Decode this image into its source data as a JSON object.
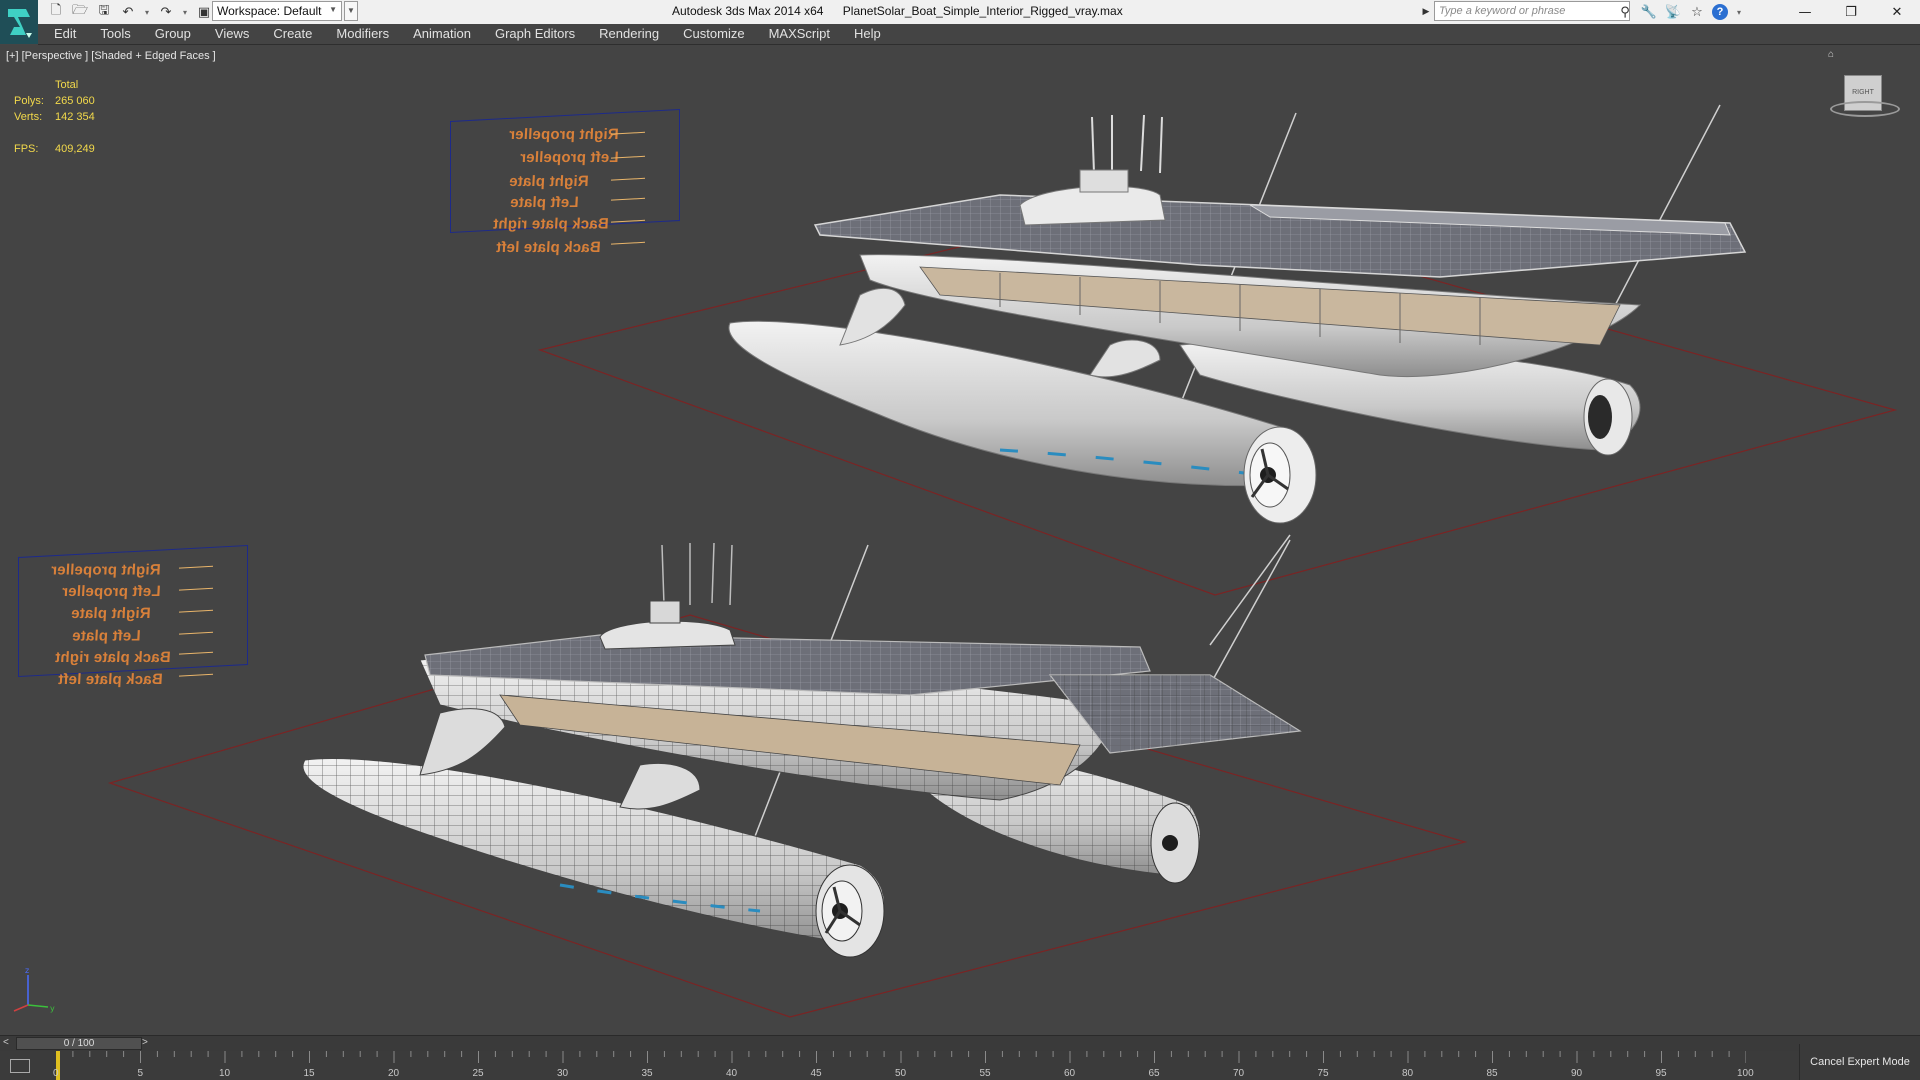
{
  "titlebar": {
    "app_name": "Autodesk 3ds Max  2014 x64",
    "file_name": "PlanetSolar_Boat_Simple_Interior_Rigged_vray.max",
    "workspace_label": "Workspace: Default",
    "search_placeholder": "Type a keyword or phrase"
  },
  "menu": [
    "Edit",
    "Tools",
    "Group",
    "Views",
    "Create",
    "Modifiers",
    "Animation",
    "Graph Editors",
    "Rendering",
    "Customize",
    "MAXScript",
    "Help"
  ],
  "viewport": {
    "label": "[+] [Perspective ] [Shaded + Edged Faces ]",
    "stats": {
      "header": "Total",
      "polys_label": "Polys:",
      "polys_value": "265 060",
      "verts_label": "Verts:",
      "verts_value": "142 354",
      "fps_label": "FPS:",
      "fps_value": "409,249"
    },
    "rig_labels_top": [
      "Right propeller",
      "Left propeller",
      "Right plate",
      "Left plate",
      "Back plate right",
      "Back plate left"
    ],
    "rig_labels_bottom": [
      "Right propeller",
      "Left propeller",
      "Right plate",
      "Left plate",
      "Back plate right",
      "Back plate left"
    ],
    "viewcube_text": "RIGHT"
  },
  "timeline": {
    "frame_display": "0 / 100",
    "prev_label": "<",
    "next_label": ">",
    "ticks": [
      "0",
      "5",
      "10",
      "15",
      "20",
      "25",
      "30",
      "35",
      "40",
      "45",
      "50",
      "55",
      "60",
      "65",
      "70",
      "75",
      "80",
      "85",
      "90",
      "95",
      "100"
    ]
  },
  "status": {
    "cancel_expert_mode": "Cancel Expert Mode"
  },
  "colors": {
    "viewport_bg": "#444444",
    "stats_text": "#f2d94b",
    "label_text": "#d8803a",
    "grid_line": "#7a2424"
  }
}
